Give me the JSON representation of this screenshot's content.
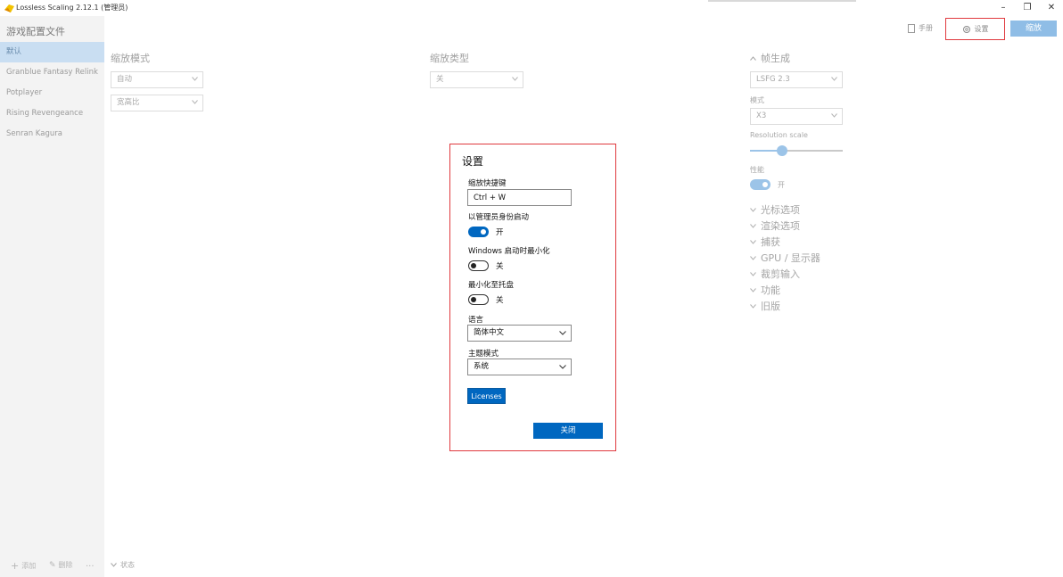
{
  "window": {
    "title": "Lossless Scaling 2.12.1 (管理员)",
    "controls": {
      "minimize": "–",
      "restore": "❐",
      "close": "✕"
    }
  },
  "sidebar": {
    "title": "游戏配置文件",
    "items": [
      {
        "label": "默认",
        "active": true
      },
      {
        "label": "Granblue Fantasy Relink",
        "active": false
      },
      {
        "label": "Potplayer",
        "active": false
      },
      {
        "label": "Rising Revengeance",
        "active": false
      },
      {
        "label": "Senran Kagura",
        "active": false
      }
    ],
    "add_label": "添加",
    "delete_label": "删除",
    "more_label": "...",
    "status_label": "状态"
  },
  "header": {
    "manual_label": "手册",
    "settings_label": "设置",
    "scale_label": "缩放"
  },
  "scaling_mode": {
    "heading": "缩放模式",
    "mode_value": "自动",
    "aspect_value": "宽高比"
  },
  "scaling_type": {
    "heading": "缩放类型",
    "value": "关"
  },
  "frame_gen": {
    "heading": "帧生成",
    "type_value": "LSFG 2.3",
    "mode_label": "模式",
    "mode_value": "X3",
    "resolution_label": "Resolution scale",
    "resolution_value": 0.35,
    "performance_label": "性能",
    "performance_state": "开"
  },
  "sections": [
    "光标选项",
    "渲染选项",
    "捕获",
    "GPU / 显示器",
    "裁剪输入",
    "功能",
    "旧版"
  ],
  "dialog": {
    "title": "设置",
    "hotkey_label": "缩放快捷键",
    "hotkey_value": "Ctrl + W",
    "admin_label": "以管理员身份启动",
    "admin_state": "开",
    "minimize_start_label": "Windows 启动时最小化",
    "minimize_start_state": "关",
    "tray_label": "最小化至托盘",
    "tray_state": "关",
    "language_label": "语言",
    "language_value": "简体中文",
    "theme_label": "主题模式",
    "theme_value": "系统",
    "licenses_label": "Licenses",
    "close_label": "关闭"
  },
  "colors": {
    "accent": "#0067c0",
    "highlight_border": "#e0393e",
    "faded_accent": "#9cc4e8"
  }
}
